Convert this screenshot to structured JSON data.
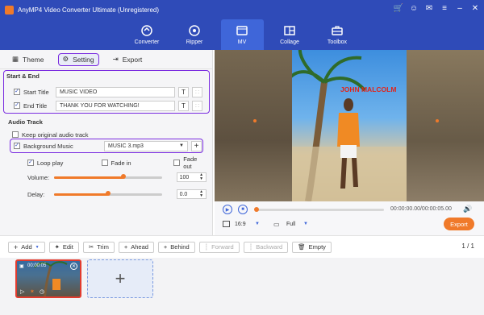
{
  "app": {
    "title": "AnyMP4 Video Converter Ultimate (Unregistered)",
    "window_controls": [
      "cart-icon",
      "user-icon",
      "chat-icon",
      "menu-icon",
      "minimize-icon",
      "close-icon"
    ]
  },
  "nav": {
    "tabs": [
      {
        "label": "Converter",
        "icon": "converter-icon"
      },
      {
        "label": "Ripper",
        "icon": "ripper-icon"
      },
      {
        "label": "MV",
        "icon": "mv-icon",
        "active": true
      },
      {
        "label": "Collage",
        "icon": "collage-icon"
      },
      {
        "label": "Toolbox",
        "icon": "toolbox-icon"
      }
    ]
  },
  "subtabs": {
    "theme": "Theme",
    "setting": "Setting",
    "export": "Export"
  },
  "start_end": {
    "heading": "Start & End",
    "start_label": "Start Title",
    "start_value": "MUSIC VIDEO",
    "end_label": "End Title",
    "end_value": "THANK YOU FOR WATCHING!"
  },
  "audio": {
    "heading": "Audio Track",
    "keep_original": "Keep original audio track",
    "bg_music_label": "Background Music",
    "bg_music_value": "MUSIC 3.mp3",
    "loop_play": "Loop play",
    "fade_in": "Fade in",
    "fade_out": "Fade out",
    "volume_label": "Volume:",
    "volume_value": "100",
    "volume_level": 0.64,
    "delay_label": "Delay:",
    "delay_value": "0.0",
    "delay_level": 0.5
  },
  "preview": {
    "overlay_text": "JOHN MALCOLM"
  },
  "player": {
    "time": "00:00:00.00/00:00:05.00",
    "aspect": "16:9",
    "view": "Full",
    "export_label": "Export",
    "progress": 0.0
  },
  "toolbar": {
    "add": "Add",
    "edit": "Edit",
    "trim": "Trim",
    "ahead": "Ahead",
    "behind": "Behind",
    "forward": "Forward",
    "backward": "Backward",
    "empty": "Empty",
    "pagination": "1 / 1"
  },
  "timeline": {
    "clip_duration": "00:00:05"
  },
  "colors": {
    "brand_blue": "#2f4bb8",
    "active_tab": "#3f66d9",
    "accent_orange": "#f07a2a",
    "highlight_purple": "#7a2be0"
  }
}
